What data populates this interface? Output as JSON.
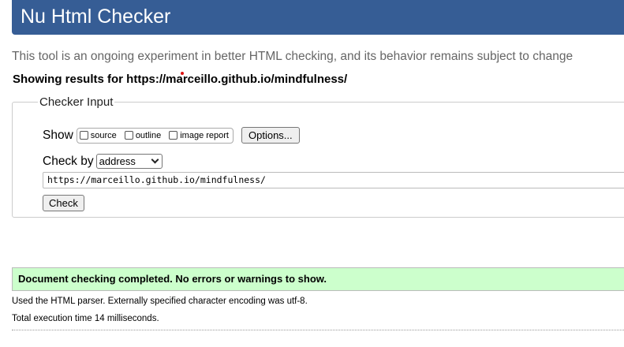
{
  "header": {
    "title": "Nu Html Checker"
  },
  "tagline": "This tool is an ongoing experiment in better HTML checking, and its behavior remains subject to change",
  "showing_results": "Showing results for https://marceillo.github.io/mindfulness/",
  "checker": {
    "legend": "Checker Input",
    "show_label": "Show",
    "options": [
      {
        "label": "source",
        "checked": false
      },
      {
        "label": "outline",
        "checked": false
      },
      {
        "label": "image report",
        "checked": false
      }
    ],
    "options_button": "Options...",
    "check_by_label": "Check by",
    "check_by_value": "address",
    "url_value": "https://marceillo.github.io/mindfulness/",
    "check_button": "Check"
  },
  "result": {
    "status": "Document checking completed. No errors or warnings to show.",
    "status_color": "#ccffcc",
    "parser_note": "Used the HTML parser. Externally specified character encoding was utf-8.",
    "execution_time": "Total execution time 14 milliseconds."
  },
  "colors": {
    "header_bg": "#365d95"
  }
}
